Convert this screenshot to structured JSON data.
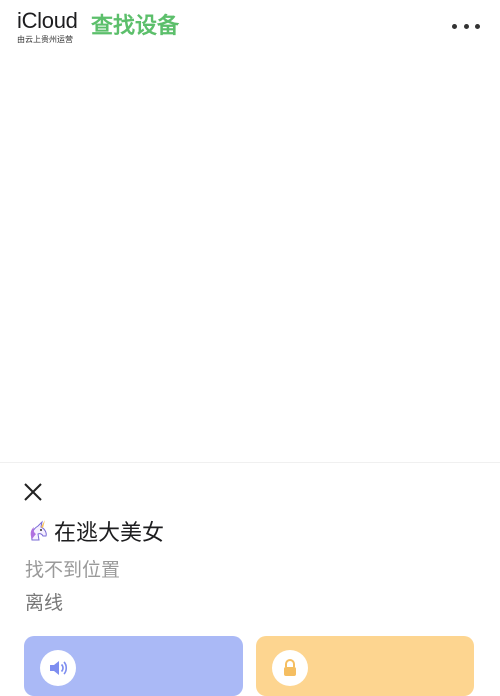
{
  "header": {
    "brand_name": "iCloud",
    "brand_subtitle": "由云上贵州运营",
    "app_title": "查找设备",
    "more_icon": "more-icon"
  },
  "device": {
    "name": "在逃大美女",
    "emoji_icon": "unicorn-icon",
    "location_status": "找不到位置",
    "connection_status": "离线"
  },
  "actions": [
    {
      "icon": "speaker-icon",
      "color": "#aab9f6"
    },
    {
      "icon": "lock-icon",
      "color": "#fdd590"
    }
  ],
  "colors": {
    "accent": "#5cbf6b"
  }
}
